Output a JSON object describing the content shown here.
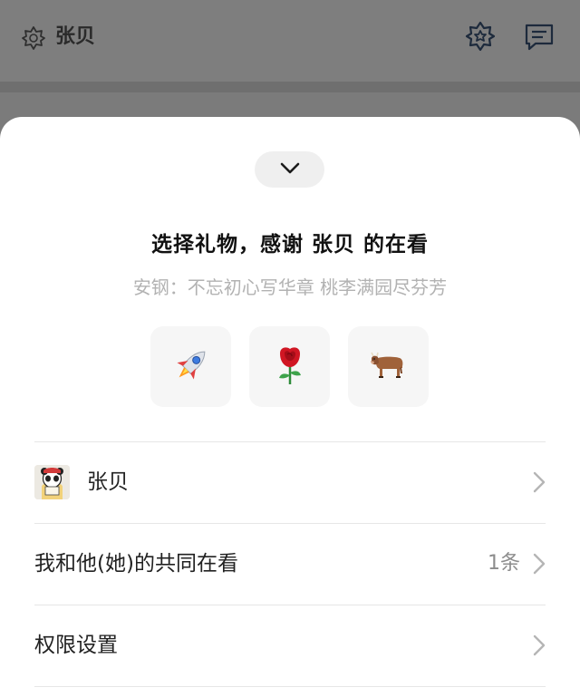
{
  "header": {
    "title": "张贝",
    "icons": [
      "shape-icon",
      "star-badge-icon",
      "message-icon"
    ]
  },
  "sheet": {
    "title": "选择礼物，感谢 张贝 的在看",
    "subtitle": "安钢：不忘初心写华章 桃李满园尽芬芳",
    "gifts": [
      {
        "name": "rocket-gift",
        "glyph": "🚀"
      },
      {
        "name": "rose-gift",
        "glyph": "🌹"
      },
      {
        "name": "cow-gift",
        "glyph": "🐄"
      }
    ],
    "rows": [
      {
        "label": "张贝"
      },
      {
        "label": "我和他(她)的共同在看",
        "count": "1条"
      },
      {
        "label": "权限设置"
      }
    ]
  },
  "colors": {
    "overlay": "#7d7d7d",
    "sheet_bg": "#ffffff",
    "subtitle": "#b2b2b2",
    "gift_tile": "#f6f6f6"
  }
}
